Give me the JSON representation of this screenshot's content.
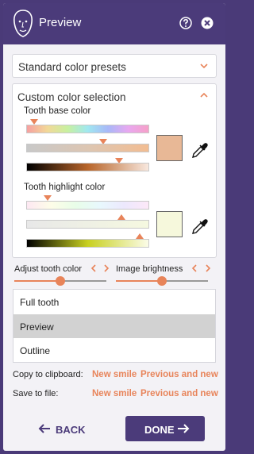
{
  "header": {
    "title": "Preview"
  },
  "presets": {
    "label": "Standard color presets"
  },
  "custom": {
    "title": "Custom color selection",
    "base_label": "Tooth base color",
    "highlight_label": "Tooth highlight color",
    "base_swatch": "#e8b896",
    "highlight_swatch": "#f6f8dc"
  },
  "adjust": {
    "tooth_label": "Adjust tooth color",
    "brightness_label": "Image brightness"
  },
  "list": {
    "items": [
      "Full tooth",
      "Preview",
      "Outline"
    ],
    "selected": "Preview"
  },
  "clipboard": {
    "label": "Copy to clipboard:",
    "new_smile": "New smile",
    "prev_new": "Previous and new"
  },
  "save": {
    "label": "Save to file:",
    "new_smile": "New smile",
    "prev_new": "Previous and new"
  },
  "footer": {
    "back": "BACK",
    "done": "DONE"
  }
}
